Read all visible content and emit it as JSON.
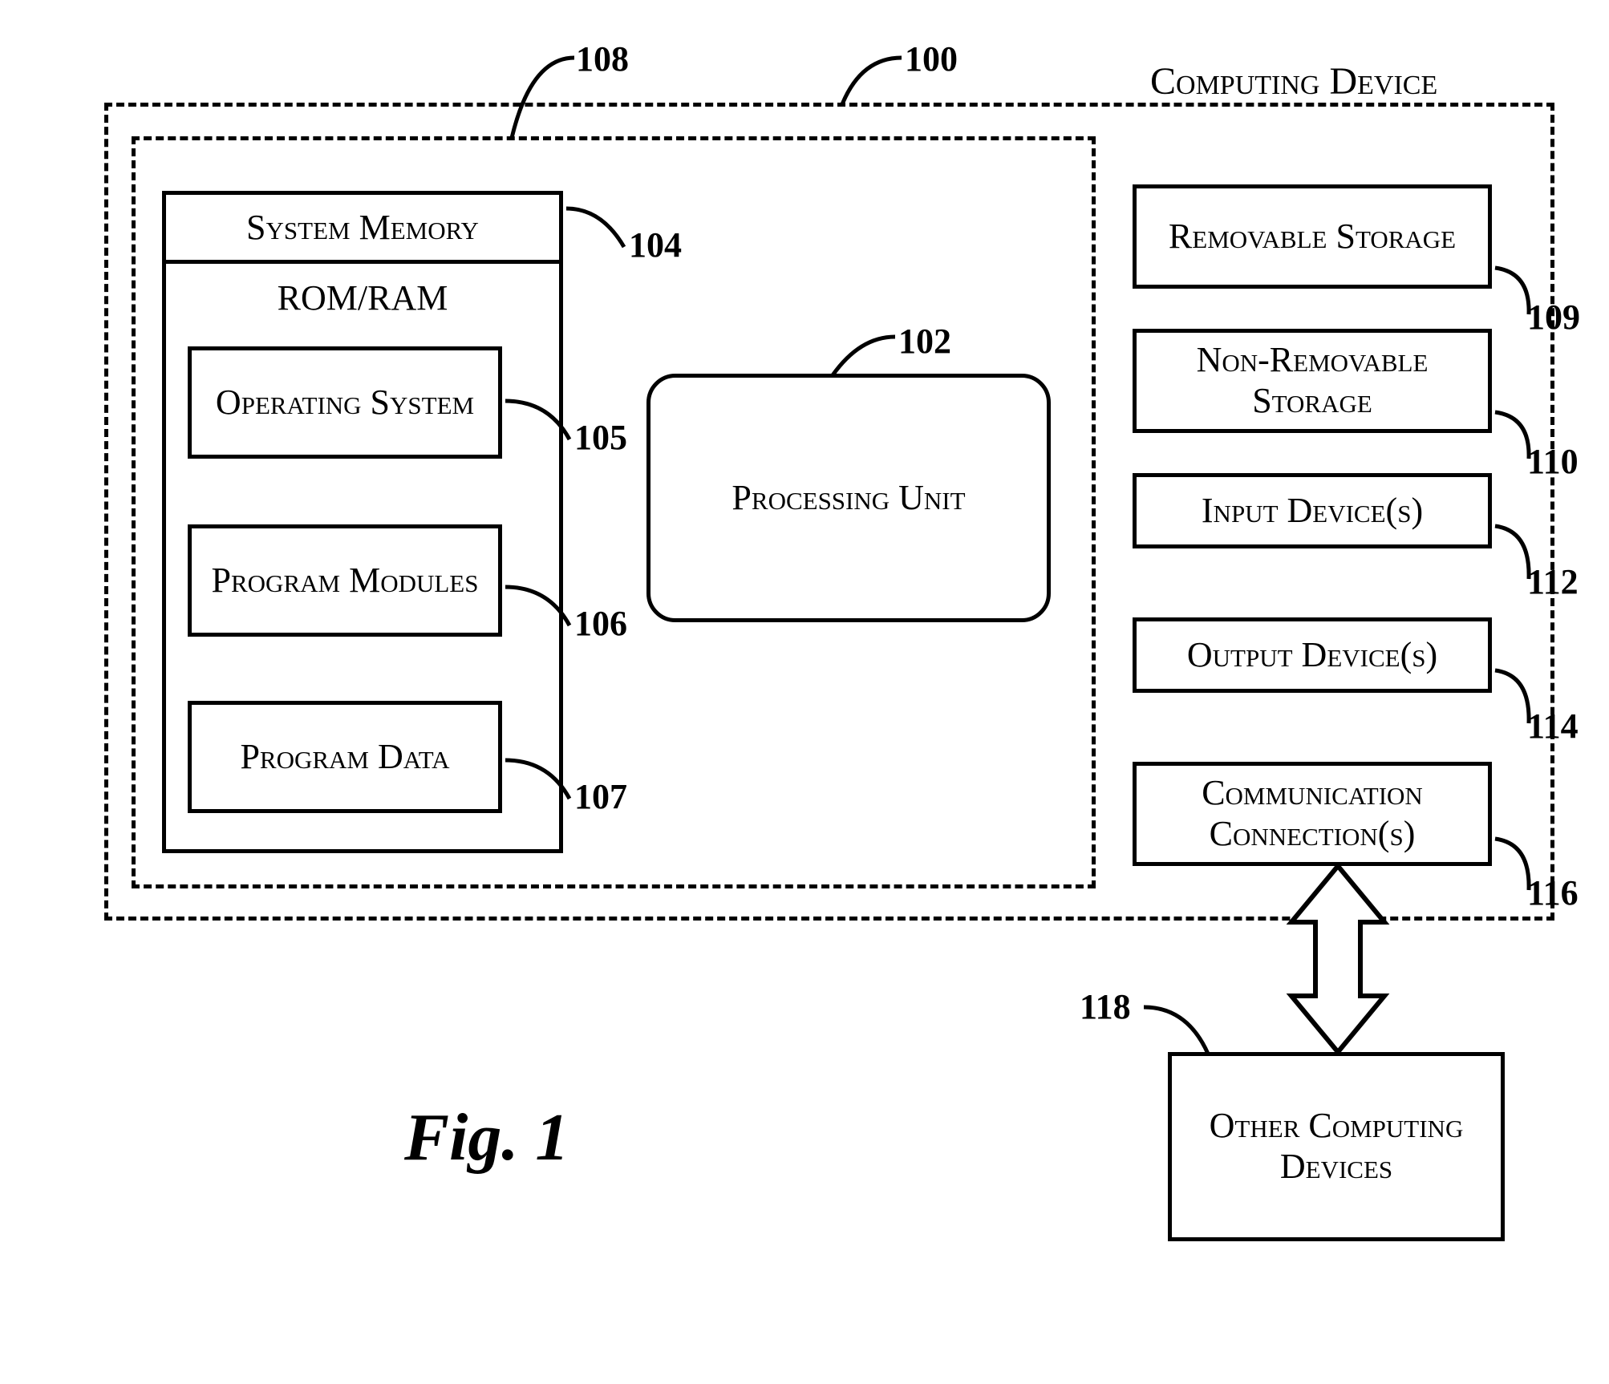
{
  "title": "Computing Device",
  "figure": "Fig. 1",
  "refs": {
    "computing_device": "100",
    "processing_unit": "102",
    "system_memory": "104",
    "operating_system": "105",
    "program_modules": "106",
    "program_data": "107",
    "inner": "108",
    "removable_storage": "109",
    "non_removable_storage": "110",
    "input_devices": "112",
    "output_devices": "114",
    "communication_connections": "116",
    "other_computing_devices": "118"
  },
  "blocks": {
    "system_memory": "System Memory",
    "rom_ram": "ROM/RAM",
    "operating_system": "Operating System",
    "program_modules": "Program Modules",
    "program_data": "Program Data",
    "processing_unit": "Processing Unit",
    "removable_storage": "Removable Storage",
    "non_removable_storage": "Non-Removable Storage",
    "input_devices": "Input Device(s)",
    "output_devices": "Output Device(s)",
    "communication_connections": "Communication Connection(s)",
    "other_computing_devices": "Other Computing Devices"
  }
}
